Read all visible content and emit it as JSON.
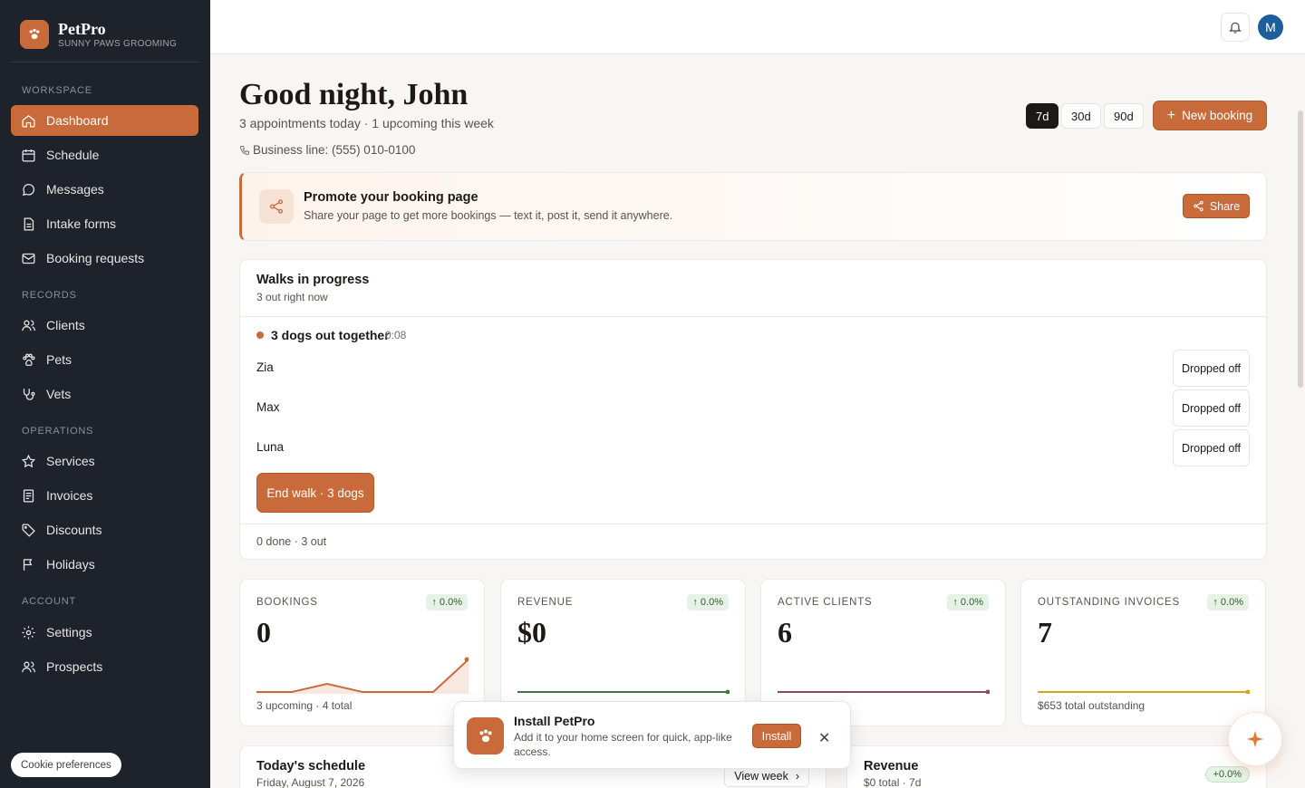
{
  "brand": {
    "name": "PetPro",
    "subtitle": "SUNNY PAWS GROOMING"
  },
  "sidebar": {
    "sections": [
      {
        "label": "WORKSPACE"
      },
      {
        "label": "RECORDS"
      },
      {
        "label": "OPERATIONS"
      },
      {
        "label": "ACCOUNT"
      }
    ],
    "items": [
      {
        "label": "Dashboard",
        "icon": "home-icon",
        "active": true
      },
      {
        "label": "Schedule",
        "icon": "calendar-icon"
      },
      {
        "label": "Messages",
        "icon": "chat-icon"
      },
      {
        "label": "Intake forms",
        "icon": "file-icon"
      },
      {
        "label": "Booking requests",
        "icon": "mail-icon"
      },
      {
        "label": "Clients",
        "icon": "users-icon"
      },
      {
        "label": "Pets",
        "icon": "paw-icon"
      },
      {
        "label": "Vets",
        "icon": "stethoscope-icon"
      },
      {
        "label": "Services",
        "icon": "star-icon"
      },
      {
        "label": "Invoices",
        "icon": "receipt-icon"
      },
      {
        "label": "Discounts",
        "icon": "tag-icon"
      },
      {
        "label": "Holidays",
        "icon": "flag-icon"
      },
      {
        "label": "Settings",
        "icon": "gear-icon"
      },
      {
        "label": "Prospects",
        "icon": "users-icon"
      }
    ],
    "cookie_label": "Cookie preferences"
  },
  "topbar": {
    "avatar_initial": "M"
  },
  "header": {
    "greeting": "Good night, John",
    "summary": "3 appointments today · 1 upcoming this week",
    "phone": "Business line: (555) 010-0100",
    "ranges": [
      "7d",
      "30d",
      "90d"
    ],
    "selected_range": "7d",
    "new_booking_label": "New booking"
  },
  "promo": {
    "title": "Promote your booking page",
    "subtitle": "Share your page to get more bookings — text it, post it, send it anywhere.",
    "share_label": "Share"
  },
  "walks": {
    "title": "Walks in progress",
    "subtitle": "3 out right now",
    "group_name": "3 dogs out together",
    "group_time": "0:08",
    "dogs": [
      {
        "name": "Zia",
        "action": "Dropped off"
      },
      {
        "name": "Max",
        "action": "Dropped off"
      },
      {
        "name": "Luna",
        "action": "Dropped off"
      }
    ],
    "end_label": "End walk · 3 dogs",
    "footer": "0 done   · 3 out"
  },
  "stats": [
    {
      "label": "BOOKINGS",
      "change": "↑ 0.0%",
      "value": "0",
      "foot": "3 upcoming · 4 total",
      "color": "#c96a3a",
      "spark": [
        0,
        0,
        1,
        0,
        0,
        0,
        4
      ],
      "fill": true
    },
    {
      "label": "REVENUE",
      "change": "↑ 0.0%",
      "value": "$0",
      "foot": "",
      "color": "#3f7a3f",
      "spark": [
        0,
        0,
        0,
        0,
        0,
        0,
        0
      ],
      "fill": false
    },
    {
      "label": "ACTIVE CLIENTS",
      "change": "↑ 0.0%",
      "value": "6",
      "foot": "",
      "color": "#8a4a6a",
      "spark": [
        0,
        0,
        0,
        0,
        0,
        0,
        0
      ],
      "fill": false
    },
    {
      "label": "OUTSTANDING INVOICES",
      "change": "↑ 0.0%",
      "value": "7",
      "foot": "$653 total outstanding",
      "color": "#d9a21b",
      "spark": [
        0,
        0,
        0,
        0,
        0,
        0,
        0
      ],
      "fill": false
    }
  ],
  "schedule": {
    "title": "Today's schedule",
    "date": "Friday, August 7, 2026",
    "view_week_label": "View week"
  },
  "revenue": {
    "title": "Revenue",
    "subtitle": "$0 total · 7d",
    "change": "+0.0%"
  },
  "install": {
    "title": "Install PetPro",
    "subtitle": "Add it to your home screen for quick, app-like access.",
    "install_label": "Install"
  },
  "colors": {
    "accent": "#c96a3a",
    "sidebar": "#1e222b"
  }
}
